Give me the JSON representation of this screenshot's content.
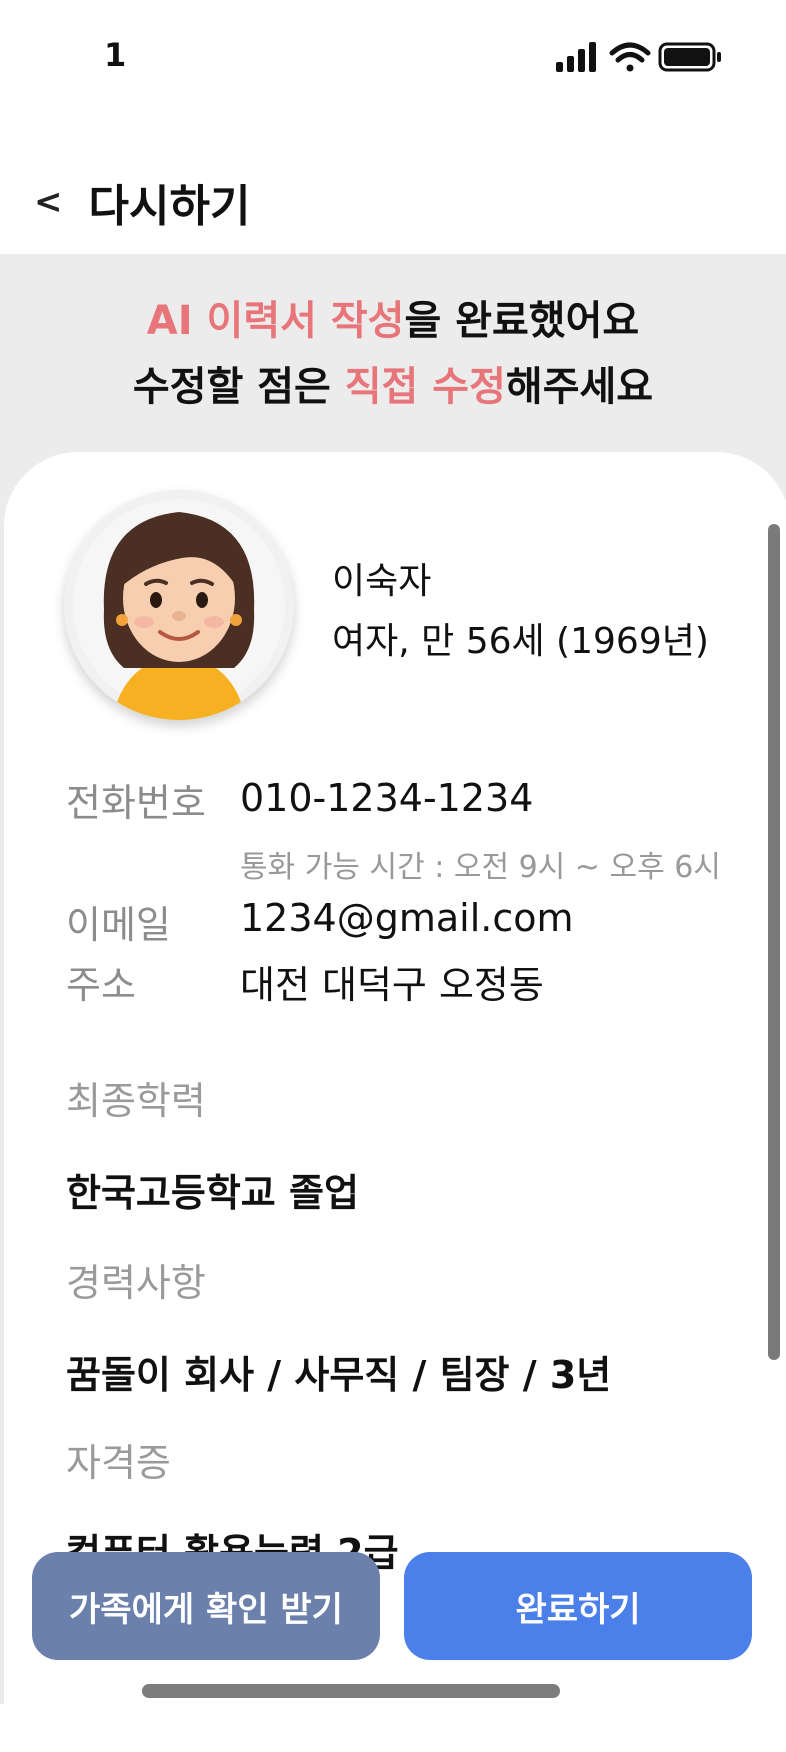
{
  "status_bar": {
    "time": "1",
    "icons": [
      "cellular-signal-icon",
      "wifi-icon",
      "battery-icon"
    ]
  },
  "nav": {
    "back_icon_glyph": "<",
    "back_label": "다시하기"
  },
  "headline": {
    "line1_accent": "AI 이력서 작성",
    "line1_rest": "을 완료했어요",
    "line2_start": "수정할 점은 ",
    "line2_accent": "직접 수정",
    "line2_rest": "해주세요"
  },
  "profile": {
    "name": "이숙자",
    "meta": "여자, 만 56세 (1969년)"
  },
  "contact": {
    "phone_label": "전화번호",
    "phone_value": "010-1234-1234",
    "phone_note": "통화 가능 시간 : 오전 9시 ~ 오후 6시",
    "email_label": "이메일",
    "email_value": "1234@gmail.com",
    "address_label": "주소",
    "address_value": "대전 대덕구 오정동"
  },
  "sections": {
    "education_label": "최종학력",
    "education_value": "한국고등학교 졸업",
    "career_label": "경력사항",
    "career_value": "꿈돌이 회사 / 사무직 / 팀장 / 3년",
    "cert_label": "자격증",
    "cert_value": "컴퓨터 활용능력 2급"
  },
  "buttons": {
    "family_check": "가족에게 확인 받기",
    "complete": "완료하기"
  },
  "colors": {
    "accent": "#e8757a",
    "family_button": "#6b80ab",
    "complete_button": "#4b7fe9",
    "background_gray": "#ececec"
  }
}
